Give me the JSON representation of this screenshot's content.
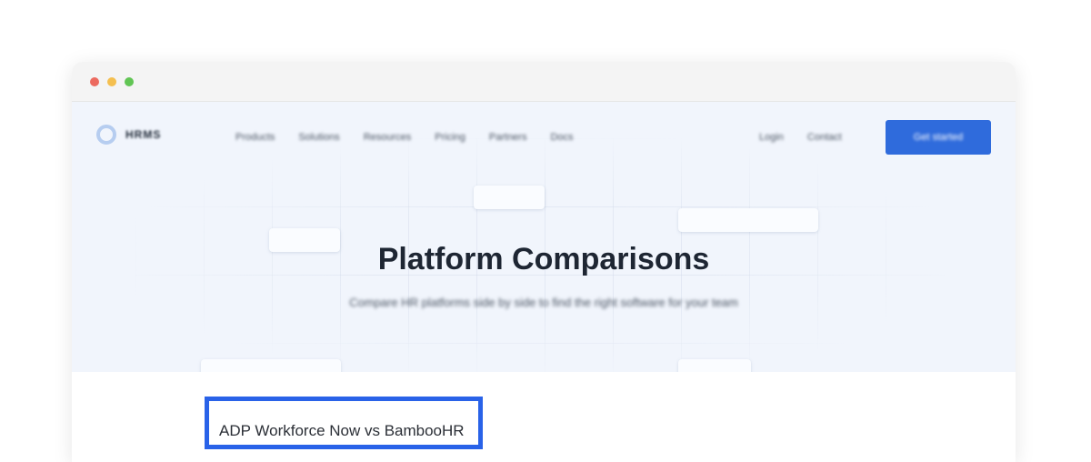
{
  "window_controls": [
    "close",
    "minimize",
    "maximize"
  ],
  "nav": {
    "logo_text": "HRMS",
    "links": [
      "Products",
      "Solutions",
      "Resources",
      "Pricing",
      "Partners",
      "Docs"
    ],
    "right_links": [
      "Login",
      "Contact"
    ],
    "cta_label": "Get started"
  },
  "hero": {
    "title": "Platform Comparisons",
    "subtitle": "Compare HR platforms side by side to find the right software for your team"
  },
  "comparisons": [
    {
      "label": "ADP Workforce Now vs BambooHR"
    }
  ],
  "colors": {
    "accent": "#2f6bdc",
    "hero_bg": "#f1f5fc",
    "title": "#1e2633",
    "highlight_border": "#2962e8"
  }
}
